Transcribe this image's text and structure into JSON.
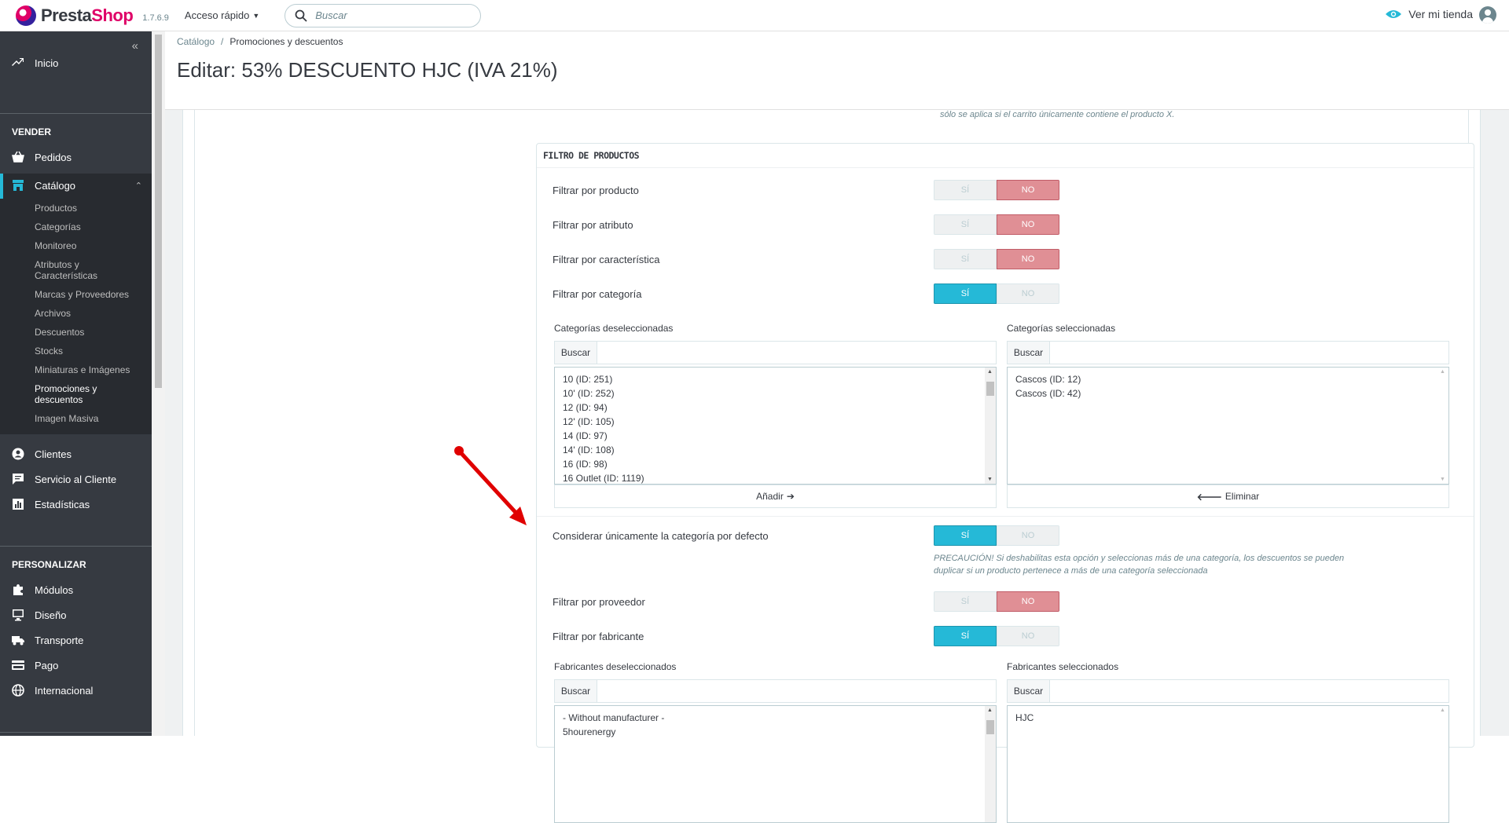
{
  "topbar": {
    "logo_presta": "Presta",
    "logo_shop": "Shop",
    "version": "1.7.6.9",
    "quick_access": "Acceso rápido",
    "search_placeholder": "Buscar",
    "view_store": "Ver mi tienda"
  },
  "sidebar": {
    "home": "Inicio",
    "section_sell": "VENDER",
    "orders": "Pedidos",
    "catalog": "Catálogo",
    "catalog_sub": [
      "Productos",
      "Categorías",
      "Monitoreo",
      "Atributos y Características",
      "Marcas y Proveedores",
      "Archivos",
      "Descuentos",
      "Stocks",
      "Miniaturas e Imágenes",
      "Promociones y descuentos",
      "Imagen Masiva"
    ],
    "customers": "Clientes",
    "customer_service": "Servicio al Cliente",
    "stats": "Estadísticas",
    "section_customize": "PERSONALIZAR",
    "modules": "Módulos",
    "design": "Diseño",
    "shipping": "Transporte",
    "payment": "Pago",
    "international": "Internacional"
  },
  "header": {
    "breadcrumb_parent": "Catálogo",
    "breadcrumb_current": "Promociones y descuentos",
    "title": "Editar: 53% DESCUENTO HJC (IVA 21%)"
  },
  "form": {
    "hint_top": "sólo se aplica si el carrito únicamente contiene el producto X.",
    "filter_title": "FILTRO DE PRODUCTOS",
    "yes": "SÍ",
    "no": "NO",
    "rows": {
      "product": "Filtrar por producto",
      "attribute": "Filtrar por atributo",
      "feature": "Filtrar por característica",
      "category": "Filtrar por categoría",
      "default_category": "Considerar únicamente la categoría por defecto",
      "supplier": "Filtrar por proveedor",
      "manufacturer": "Filtrar por fabricante"
    },
    "categories_unselected_label": "Categorías deseleccionadas",
    "categories_selected_label": "Categorías seleccionadas",
    "search_btn": "Buscar",
    "categories_unselected": [
      "10 (ID: 251)",
      "10' (ID: 252)",
      "12 (ID: 94)",
      "12' (ID: 105)",
      "14 (ID: 97)",
      "14' (ID: 108)",
      "16 (ID: 98)",
      "16 Outlet (ID: 1119)"
    ],
    "categories_selected": [
      "Cascos (ID: 12)",
      "Cascos (ID: 42)"
    ],
    "add_btn": "Añadir",
    "remove_btn": "Eliminar",
    "warning": "PRECAUCIÓN! Si deshabilitas esta opción y seleccionas más de una categoría, los descuentos se pueden duplicar si un producto pertenece a más de una categoría seleccionada",
    "manufacturers_unselected_label": "Fabricantes deseleccionados",
    "manufacturers_selected_label": "Fabricantes seleccionados",
    "manufacturers_unselected": [
      "- Without manufacturer -",
      "5hourenergy"
    ],
    "manufacturers_selected": [
      "HJC"
    ]
  }
}
